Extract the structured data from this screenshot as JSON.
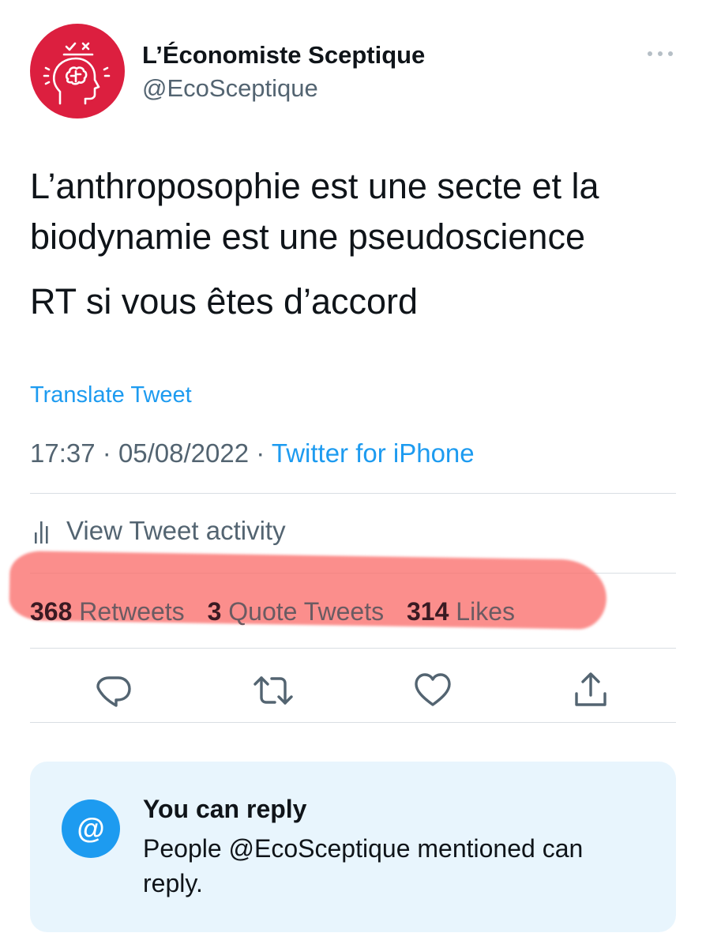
{
  "author": {
    "display_name": "L’Économiste Sceptique",
    "handle": "@EcoSceptique",
    "avatar_color": "#dc1f3f",
    "avatar_icon": "head-brain-icon"
  },
  "tweet": {
    "line_1": "L’anthroposophie est une secte et la biodynamie est une pseudoscience",
    "line_2": "RT si vous êtes d’accord"
  },
  "translate_label": "Translate Tweet",
  "meta": {
    "time": "17:37",
    "separator": "·",
    "date": "05/08/2022",
    "source": "Twitter for iPhone"
  },
  "activity": {
    "icon": "bar-chart-icon",
    "label": "View Tweet activity"
  },
  "stats": {
    "retweets_count": "368",
    "retweets_label": "Retweets",
    "quotes_count": "3",
    "quotes_label": "Quote Tweets",
    "likes_count": "314",
    "likes_label": "Likes",
    "highlight_color": "#fa6e6c"
  },
  "actions": [
    "reply-icon",
    "retweet-icon",
    "like-icon",
    "share-icon"
  ],
  "reply_card": {
    "icon_glyph": "@",
    "title": "You can reply",
    "body": "People @EcoSceptique mentioned can reply."
  },
  "colors": {
    "accent": "#1d9bf0",
    "secondary_text": "#536471",
    "primary_text": "#0f1419",
    "card_background": "#e8f5fd"
  }
}
